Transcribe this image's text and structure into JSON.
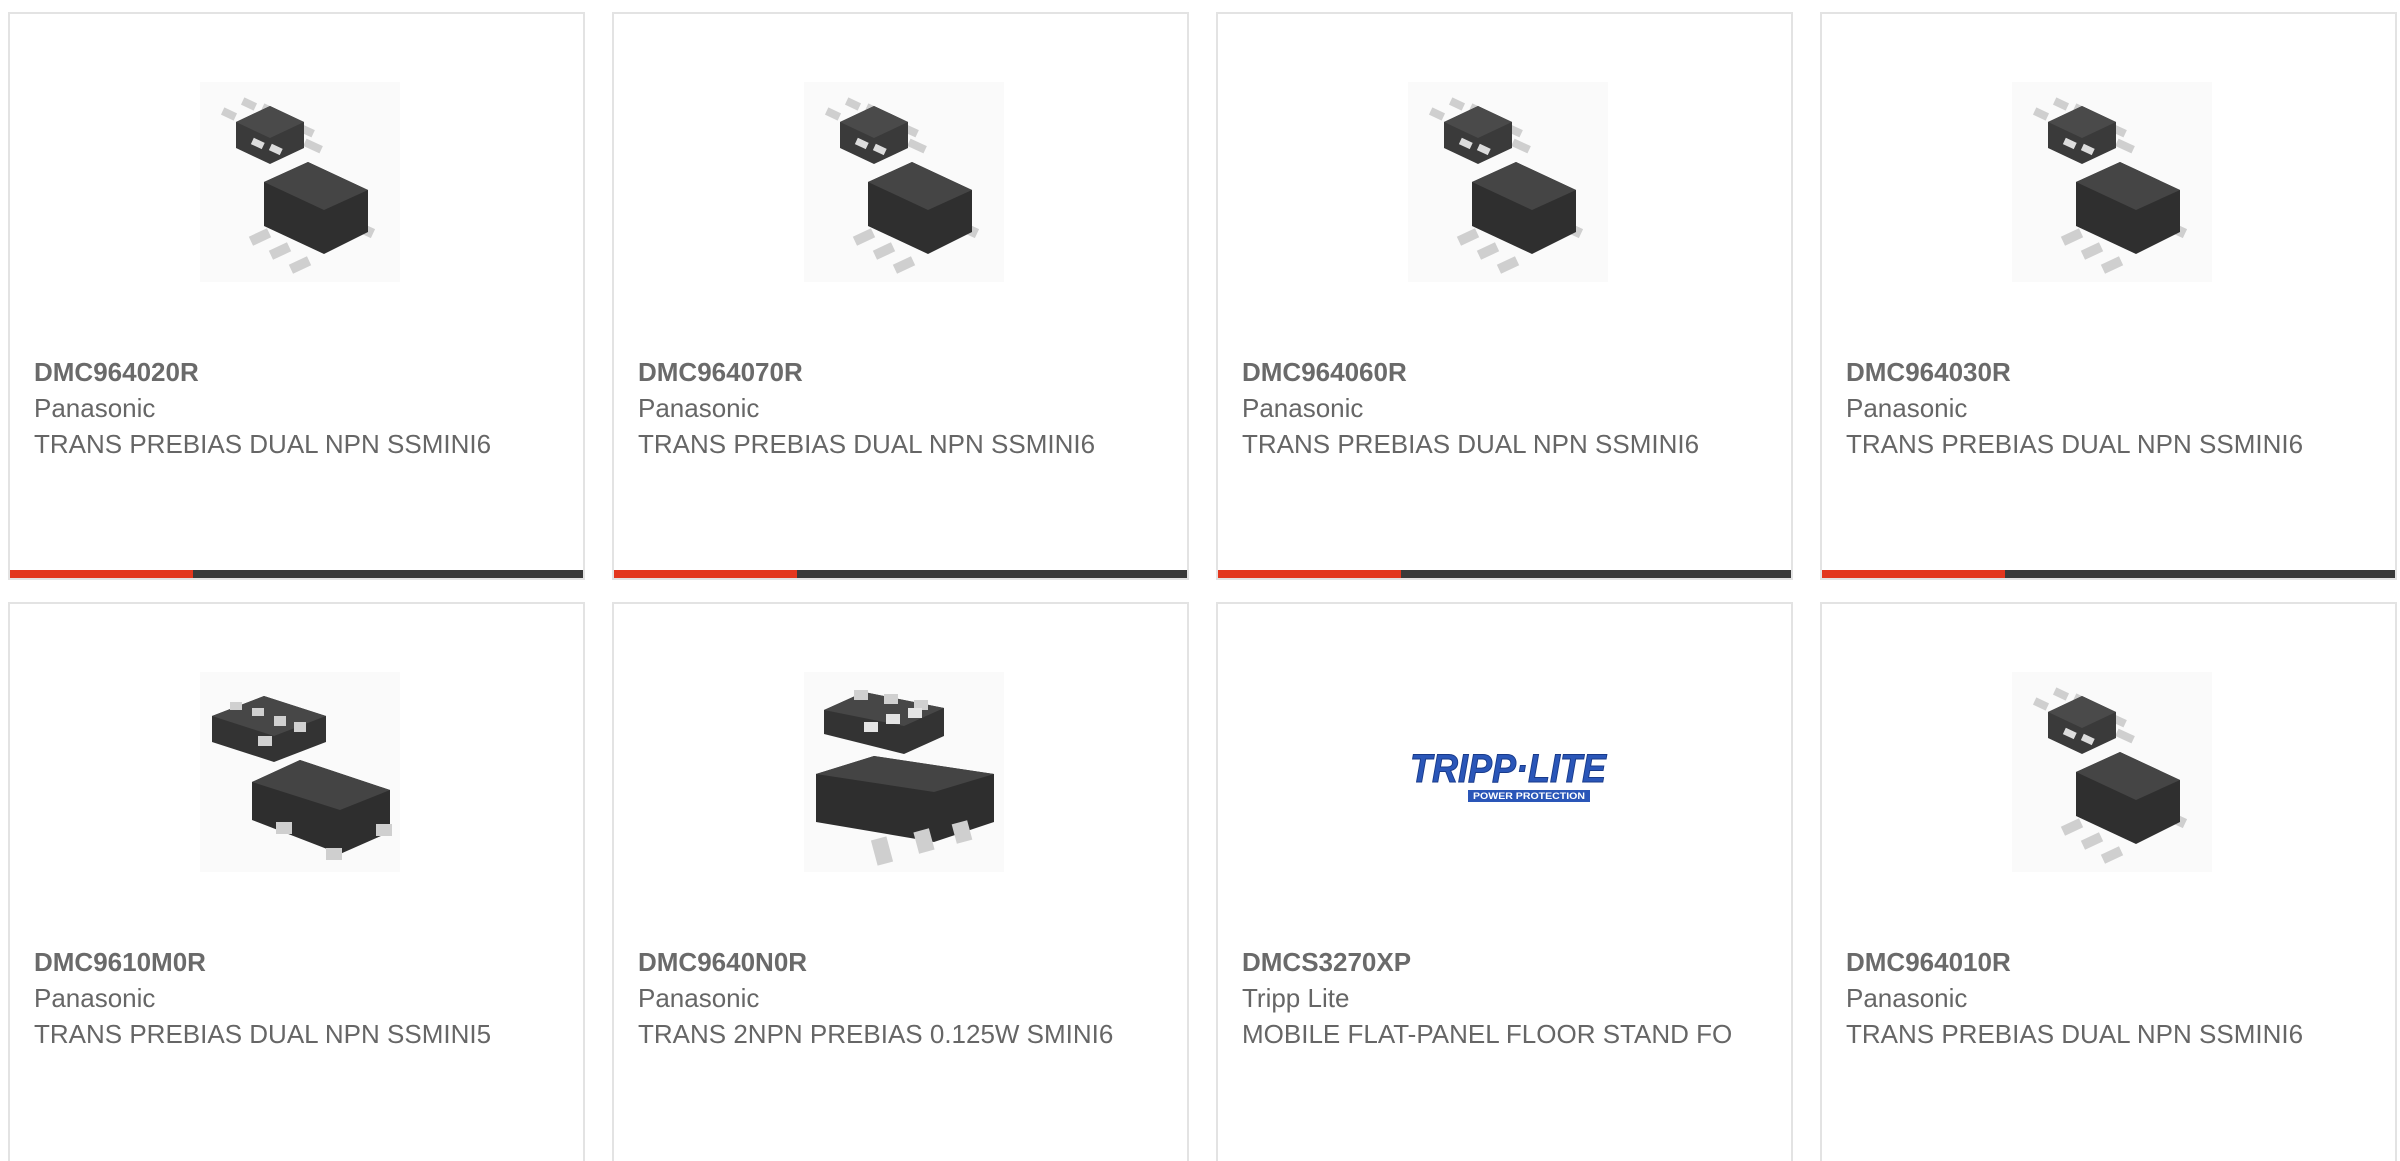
{
  "accent_color": "#e3371e",
  "bar_track_color": "#3a3a3a",
  "products": [
    {
      "part": "DMC964020R",
      "manufacturer": "Panasonic",
      "description": "TRANS PREBIAS DUAL NPN SSMINI6",
      "image": "chip-6pin-icon",
      "show_bar": true,
      "bar_fraction": 0.32
    },
    {
      "part": "DMC964070R",
      "manufacturer": "Panasonic",
      "description": "TRANS PREBIAS DUAL NPN SSMINI6",
      "image": "chip-6pin-icon",
      "show_bar": true,
      "bar_fraction": 0.32
    },
    {
      "part": "DMC964060R",
      "manufacturer": "Panasonic",
      "description": "TRANS PREBIAS DUAL NPN SSMINI6",
      "image": "chip-6pin-icon",
      "show_bar": true,
      "bar_fraction": 0.32
    },
    {
      "part": "DMC964030R",
      "manufacturer": "Panasonic",
      "description": "TRANS PREBIAS DUAL NPN SSMINI6",
      "image": "chip-6pin-icon",
      "show_bar": true,
      "bar_fraction": 0.32
    },
    {
      "part": "DMC9610M0R",
      "manufacturer": "Panasonic",
      "description": "TRANS PREBIAS DUAL NPN SSMINI5",
      "image": "chip-5pin-icon",
      "show_bar": false
    },
    {
      "part": "DMC9640N0R",
      "manufacturer": "Panasonic",
      "description": "TRANS 2NPN PREBIAS 0.125W SMINI6",
      "image": "chip-large-icon",
      "show_bar": false
    },
    {
      "part": "DMCS3270XP",
      "manufacturer": "Tripp Lite",
      "description": "MOBILE FLAT-PANEL FLOOR STAND FO",
      "image": "tripp-lite-logo",
      "logo_text": "TRIPP·LITE",
      "logo_subtext": "POWER PROTECTION",
      "show_bar": false
    },
    {
      "part": "DMC964010R",
      "manufacturer": "Panasonic",
      "description": "TRANS PREBIAS DUAL NPN SSMINI6",
      "image": "chip-6pin-icon",
      "show_bar": false
    }
  ]
}
